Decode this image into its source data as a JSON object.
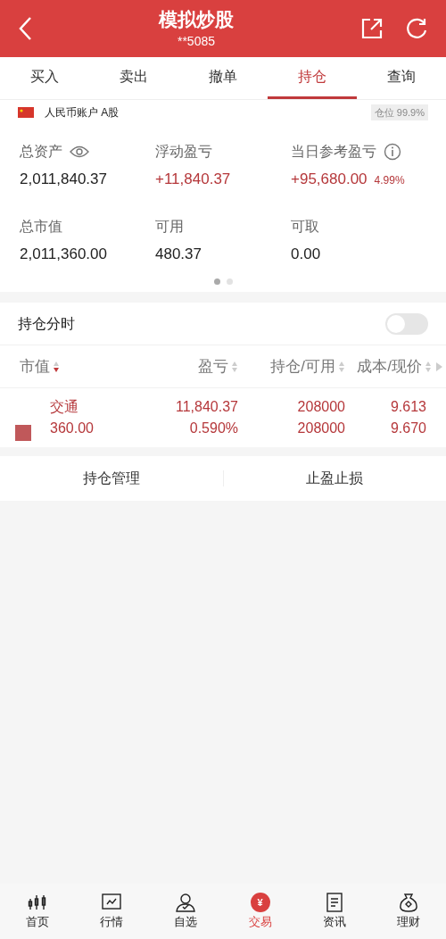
{
  "header": {
    "title": "模拟炒股",
    "subtitle": "**5085"
  },
  "tabs": [
    {
      "label": "买入",
      "selected": false
    },
    {
      "label": "卖出",
      "selected": false
    },
    {
      "label": "撤单",
      "selected": false
    },
    {
      "label": "持仓",
      "selected": true
    },
    {
      "label": "查询",
      "selected": false
    }
  ],
  "account": {
    "label": "人民币账户 A股",
    "position": "仓位 99.9%"
  },
  "stats": [
    {
      "label": "总资产",
      "value": "2,011,840.37",
      "kind": "eye",
      "positive": false
    },
    {
      "label": "浮动盈亏",
      "value": "+11,840.37",
      "kind": "none",
      "positive": true
    },
    {
      "label": "当日参考盈亏",
      "value": "+95,680.00",
      "extra": "4.99%",
      "kind": "info",
      "positive": true
    },
    {
      "label": "总市值",
      "value": "2,011,360.00",
      "kind": "none",
      "positive": false
    },
    {
      "label": "可用",
      "value": "480.37",
      "kind": "none",
      "positive": false
    },
    {
      "label": "可取",
      "value": "0.00",
      "kind": "none",
      "positive": false
    }
  ],
  "pager": [
    {
      "selected": true
    },
    {
      "selected": false
    }
  ],
  "intraday": {
    "label": "持仓分时",
    "on": false
  },
  "table": {
    "columns": [
      {
        "label": "市值",
        "sorted": true
      },
      {
        "label": "盈亏",
        "sorted": false
      },
      {
        "label": "持仓/可用",
        "sorted": false
      },
      {
        "label": "成本/现价",
        "sorted": false
      }
    ],
    "rows": [
      {
        "cells": [
          [
            "交通",
            "360.00"
          ],
          [
            "11,840.37",
            "0.590%"
          ],
          [
            "208000",
            "208000"
          ],
          [
            "9.613",
            "9.670"
          ]
        ]
      }
    ]
  },
  "actions": [
    "持仓管理",
    "止盈止损"
  ],
  "nav": [
    {
      "label": "首页",
      "kind": "candles",
      "selected": false
    },
    {
      "label": "行情",
      "kind": "chart",
      "selected": false
    },
    {
      "label": "自选",
      "kind": "person",
      "selected": false
    },
    {
      "label": "交易",
      "kind": "yen",
      "glyph": "¥",
      "selected": true
    },
    {
      "label": "资讯",
      "kind": "doc",
      "selected": false
    },
    {
      "label": "理财",
      "kind": "bag",
      "selected": false
    }
  ]
}
